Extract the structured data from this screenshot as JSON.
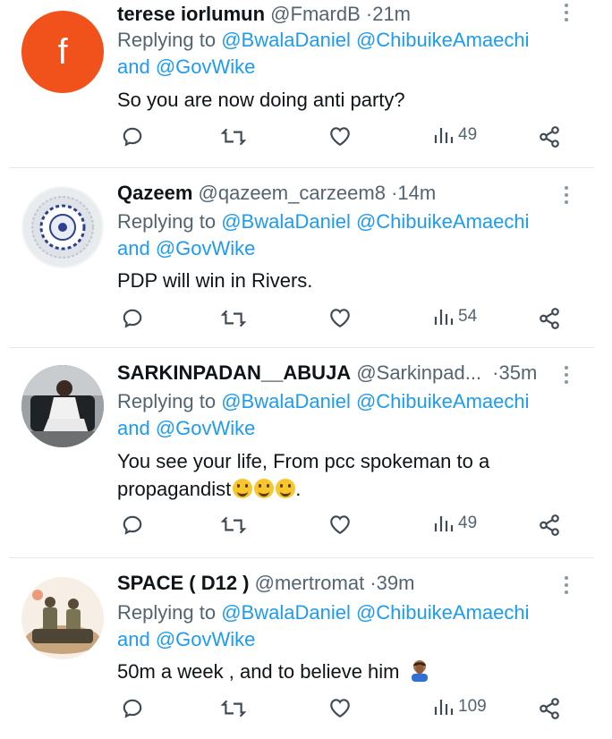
{
  "tweets": [
    {
      "name": "terese iorlumun",
      "handle": "@FmardB",
      "time": "21m",
      "avatar_letter": "f",
      "reply_prefix": "Replying to",
      "mention1": "@BwalaDaniel",
      "mention2": "@ChibuikeAmaechi",
      "and": "and",
      "mention3": "@GovWike",
      "text": "So you are now doing anti party?",
      "views": "49"
    },
    {
      "name": "Qazeem",
      "handle": "@qazeem_carzeem8",
      "time": "14m",
      "reply_prefix": "Replying to",
      "mention1": "@BwalaDaniel",
      "mention2": "@ChibuikeAmaechi",
      "and": "and",
      "mention3": "@GovWike",
      "text": "PDP will win in Rivers.",
      "views": "54"
    },
    {
      "name": "SARKINPADAN__ABUJA",
      "handle": "@Sarkinpad...",
      "time": "35m",
      "reply_prefix": "Replying to",
      "mention1": "@BwalaDaniel",
      "mention2": "@ChibuikeAmaechi",
      "and": "and",
      "mention3": "@GovWike",
      "text_line1": "You see your life, From pcc spokeman to a",
      "text_line2": "propagandist",
      "text_tail": ".",
      "views": "49"
    },
    {
      "name": "SPACE ( D12 )",
      "handle": "@mertromat",
      "time": "39m",
      "reply_prefix": "Replying to",
      "mention1": "@BwalaDaniel",
      "mention2": "@ChibuikeAmaechi",
      "and": "and",
      "mention3": "@GovWike",
      "text": "50m a week , and to believe him",
      "views": "109"
    }
  ],
  "separator": "·",
  "icons": {
    "reply": "reply-icon",
    "retweet": "retweet-icon",
    "like": "heart-icon",
    "views": "analytics-icon",
    "share": "share-icon",
    "more": "more-vertical-icon"
  },
  "colors": {
    "link": "#1d9bf0",
    "muted": "#536471",
    "avatar_f": "#f1511b"
  }
}
